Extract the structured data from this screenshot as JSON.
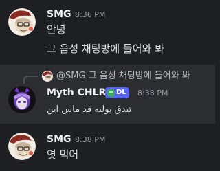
{
  "messages": [
    {
      "author": "SMG",
      "time": "8:36 PM",
      "lines": [
        "안녕",
        "그 음성 채팅방에 들어와 봐"
      ]
    },
    {
      "author": "Myth CHLR",
      "time": "8:38 PM",
      "badge": "DL",
      "reply": {
        "text": "@SMG 그 음성 채팅방에 들어와 봐"
      },
      "lines": [
        "تيدق بوليه قد ماس اين"
      ]
    },
    {
      "author": "SMG",
      "time": "8:38 PM",
      "lines": [
        "엿 먹어"
      ]
    }
  ],
  "colors": {
    "background": "#1e1f22",
    "highlight": "#2b2d31",
    "username": "#f2f3f5",
    "timestamp": "#949ba4",
    "badge": "#5865f2"
  }
}
